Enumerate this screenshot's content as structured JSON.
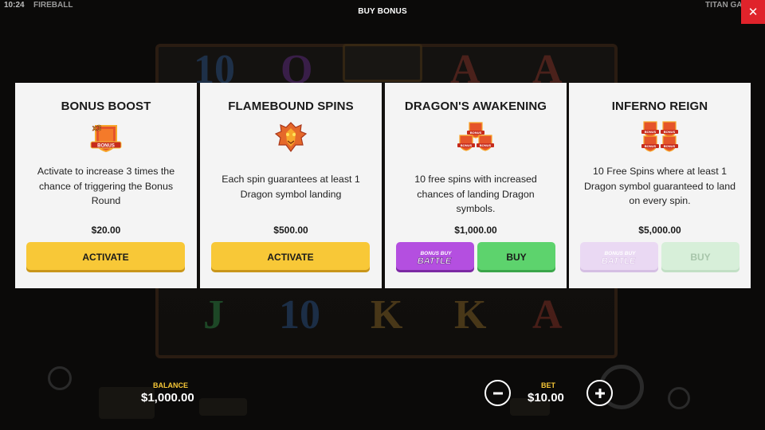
{
  "status_bar": {
    "time": "10:24",
    "game_name": "FIREBALL",
    "provider": "TITAN GA"
  },
  "header": {
    "title": "BUY BONUS",
    "close_icon": "close-icon"
  },
  "background_symbols": [
    "10",
    "Q",
    "A",
    "A",
    "J",
    "10",
    "K",
    "K",
    "A"
  ],
  "cards": [
    {
      "title": "BONUS BOOST",
      "icon": "bonus-x3-shield-icon",
      "icon_text": {
        "multiplier": "x3",
        "label": "BONUS"
      },
      "description": "Activate to increase 3 times the chance of triggering the Bonus Round",
      "price": "$20.00",
      "button": "ACTIVATE"
    },
    {
      "title": "FLAMEBOUND SPINS",
      "icon": "dragon-head-icon",
      "description": "Each spin guarantees at least 1 Dragon symbol landing",
      "price": "$500.00",
      "button": "ACTIVATE"
    },
    {
      "title": "DRAGON'S AWAKENING",
      "icon": "three-bonus-shields-icon",
      "icon_text": {
        "label": "BONUS"
      },
      "description": "10 free spins with increased chances of landing Dragon symbols.",
      "price": "$1,000.00",
      "battle_button": "BONUS BUY BATTLE",
      "button": "BUY"
    },
    {
      "title": "INFERNO REIGN",
      "icon": "four-bonus-shields-icon",
      "icon_text": {
        "label": "BONUS"
      },
      "description": "10 Free Spins where at least 1 Dragon symbol guaranteed to land on every spin.",
      "price": "$5,000.00",
      "battle_button": "BONUS BUY BATTLE",
      "button": "BUY",
      "disabled": true
    }
  ],
  "footer": {
    "balance_label": "BALANCE",
    "balance_value": "$1,000.00",
    "bet_label": "BET",
    "bet_value": "$10.00",
    "minus_icon": "minus-icon",
    "plus_icon": "plus-icon"
  },
  "colors": {
    "accent_yellow": "#f8c837",
    "buy_green": "#5dd36d",
    "battle_purple": "#b44fe0",
    "close_red": "#e0232b",
    "card_bg": "#f4f4f4"
  }
}
